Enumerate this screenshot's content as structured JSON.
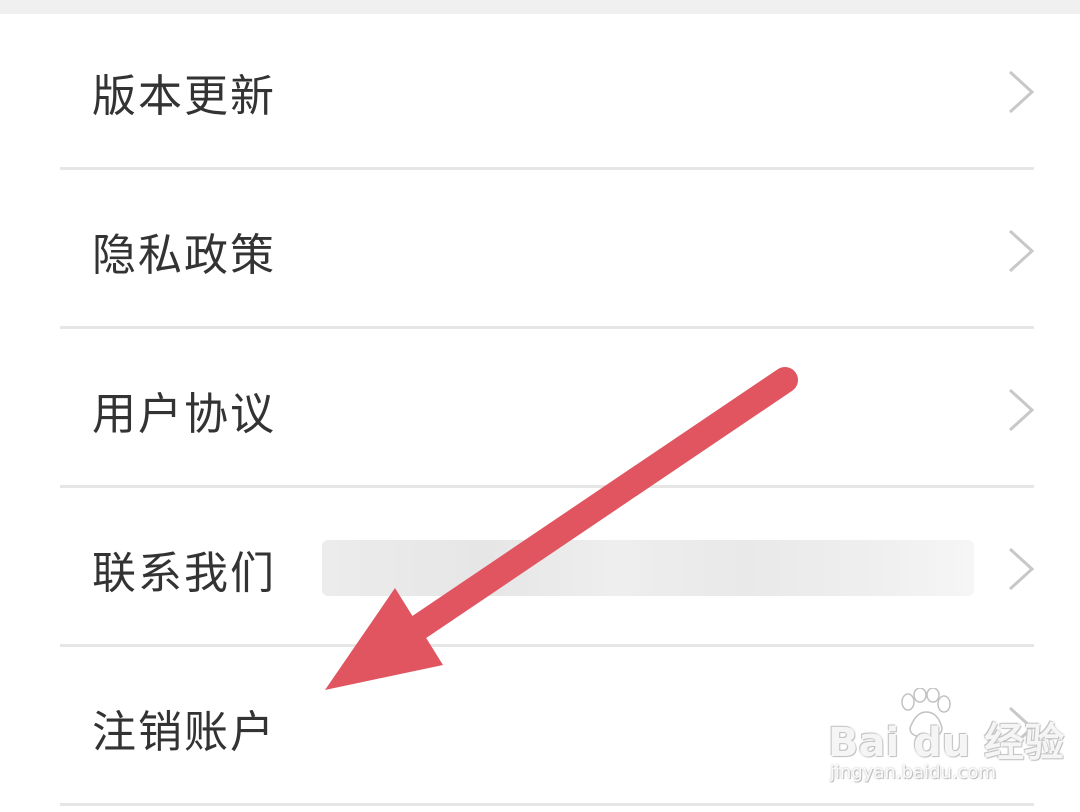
{
  "settings": {
    "items": [
      {
        "label": "版本更新",
        "icon": "chevron-right-icon"
      },
      {
        "label": "隐私政策",
        "icon": "chevron-right-icon"
      },
      {
        "label": "用户协议",
        "icon": "chevron-right-icon"
      },
      {
        "label": "联系我们",
        "icon": "chevron-right-icon"
      },
      {
        "label": "注销账户",
        "icon": "chevron-right-icon"
      }
    ]
  },
  "annotation": {
    "color": "#e05560",
    "icon": "red-arrow-icon"
  },
  "watermark": {
    "logo_text": "Bai du 经验",
    "url": "jingyan.baidu.com"
  },
  "colors": {
    "text": "#333333",
    "divider": "#e6e6e6",
    "chevron": "#c8c8c8",
    "top_gap": "#f0f0f0"
  }
}
